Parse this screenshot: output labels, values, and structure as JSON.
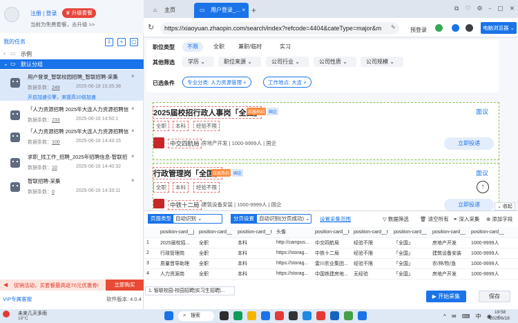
{
  "left": {
    "login": "注册 | 登录",
    "upgrade": "升级套餐",
    "free_msg": "当前为免费套餐，去升级 >>",
    "my_tasks": "我的任务",
    "groups": [
      "示例",
      "默认分组"
    ],
    "tasks": [
      {
        "title": "用户登录_智联校园招聘_智联招聘-采集",
        "count_label": "数据条数：",
        "count": "249",
        "date": "2025-06-18 15:35:38",
        "status": "开启加速引擎，来提高10倍加速"
      },
      {
        "title": "「人力资源招聘 2025年大连人力资源招聘信",
        "count_label": "数据条数：",
        "count": "233",
        "date": "2025-06-16 14:50:1"
      },
      {
        "title": "「人力资源招聘 2025年大连人力资源招聘信",
        "count_label": "数据条数：",
        "count": "100",
        "date": "2025-06-16 14:43:15"
      },
      {
        "title": "求职_找工作_招聘_2025年招聘信息-智联招",
        "count_label": "数据条数：",
        "count": "10",
        "date": "2025-06-16 14:40:32"
      },
      {
        "title": "智联招聘-采集",
        "count_label": "数据条数：",
        "count": "0",
        "date": "2025-06-16 14:33:11"
      }
    ],
    "promo": "促销活动，买套餐最高返70元优惠券!",
    "buy_now": "立即购买",
    "vip": "VIP专属客服",
    "version": "软件版本: 4.0.4"
  },
  "browser": {
    "tab_home": "主页",
    "tab_active": "用户登录_...",
    "url": "https://xiaoyuan.zhaopin.com/search/index?refcode=4404&cateType=major&m",
    "pre_login": "预登录",
    "device": "电脑浏览器"
  },
  "filters": {
    "job_type_label": "职位类型",
    "job_types": [
      "不限",
      "全职",
      "兼职/临时",
      "实习"
    ],
    "other_label": "其他筛选",
    "others": [
      "学历",
      "职位来源",
      "公司行业",
      "公司性质",
      "公司规模"
    ],
    "selected_label": "已选条件",
    "selected": [
      "专业分类: 人力资源管理",
      "工作地点: 大连"
    ]
  },
  "jobs": [
    {
      "title": "2025届校招行政人事岗「全国」",
      "hot": "应届热招",
      "qi": "国企",
      "tags": [
        "全职",
        "本科",
        "经验不限"
      ],
      "company": "中交四航局",
      "info": [
        "房地产开发",
        "1000-9999人",
        "国企"
      ],
      "salary": "面议",
      "apply": "立即投递"
    },
    {
      "title": "行政管理岗「全国」",
      "hot": "应届热招",
      "qi": "国企",
      "tags": [
        "全职",
        "本科",
        "经验不限"
      ],
      "company": "中铁十二局",
      "info": [
        "建筑设备安装",
        "1000-9999人",
        "国企"
      ],
      "salary": "面议",
      "apply": "立即投递"
    }
  ],
  "bottom": {
    "page_type_label": "页面类型",
    "page_type": "自动识别",
    "paging_label": "分页设置",
    "paging": "自动识别(分页成功)",
    "collect_range": "设置采集范围",
    "actions": [
      "数据筛选",
      "清空所有",
      "深入采集",
      "添加字段"
    ],
    "collapse": "收起",
    "columns": [
      "position-card__j",
      "position-card__",
      "position-card__t",
      "头像",
      "position-card__t",
      "position-card__t",
      "position-card__",
      "position-card__",
      "position-card__"
    ],
    "rows": [
      [
        "1",
        "2025届校招...",
        "全职",
        "本科",
        "http://campus...",
        "中交四航局",
        "经验不限",
        "「全国」",
        "房地产开发",
        "1000-9999人"
      ],
      [
        "2",
        "行政管理岗",
        "全职",
        "本科",
        "https://storag...",
        "中铁十二局",
        "经验不限",
        "「全国」",
        "建筑设备安装",
        "1000-9999人"
      ],
      [
        "3",
        "质量晋导助理",
        "全职",
        "本科",
        "https://storag...",
        "雷川农业集团...",
        "经验不限",
        "「全国」",
        "农/林/牧/渔",
        "1000-9999人"
      ],
      [
        "4",
        "人力资源岗",
        "全职",
        "本科",
        "https://storag...",
        "中国铁建房地...",
        "无经验",
        "「全国」",
        "房地产开发",
        "1000-9999人"
      ]
    ],
    "task_tab": "1. 智联校园-校园招聘|实习生招聘|...",
    "start": "开始采集",
    "save": "保存"
  },
  "taskbar": {
    "weather": "未来几天多雨",
    "temp": "19°C",
    "search": "搜索",
    "time": "19:58",
    "date": "2025/6/18"
  }
}
